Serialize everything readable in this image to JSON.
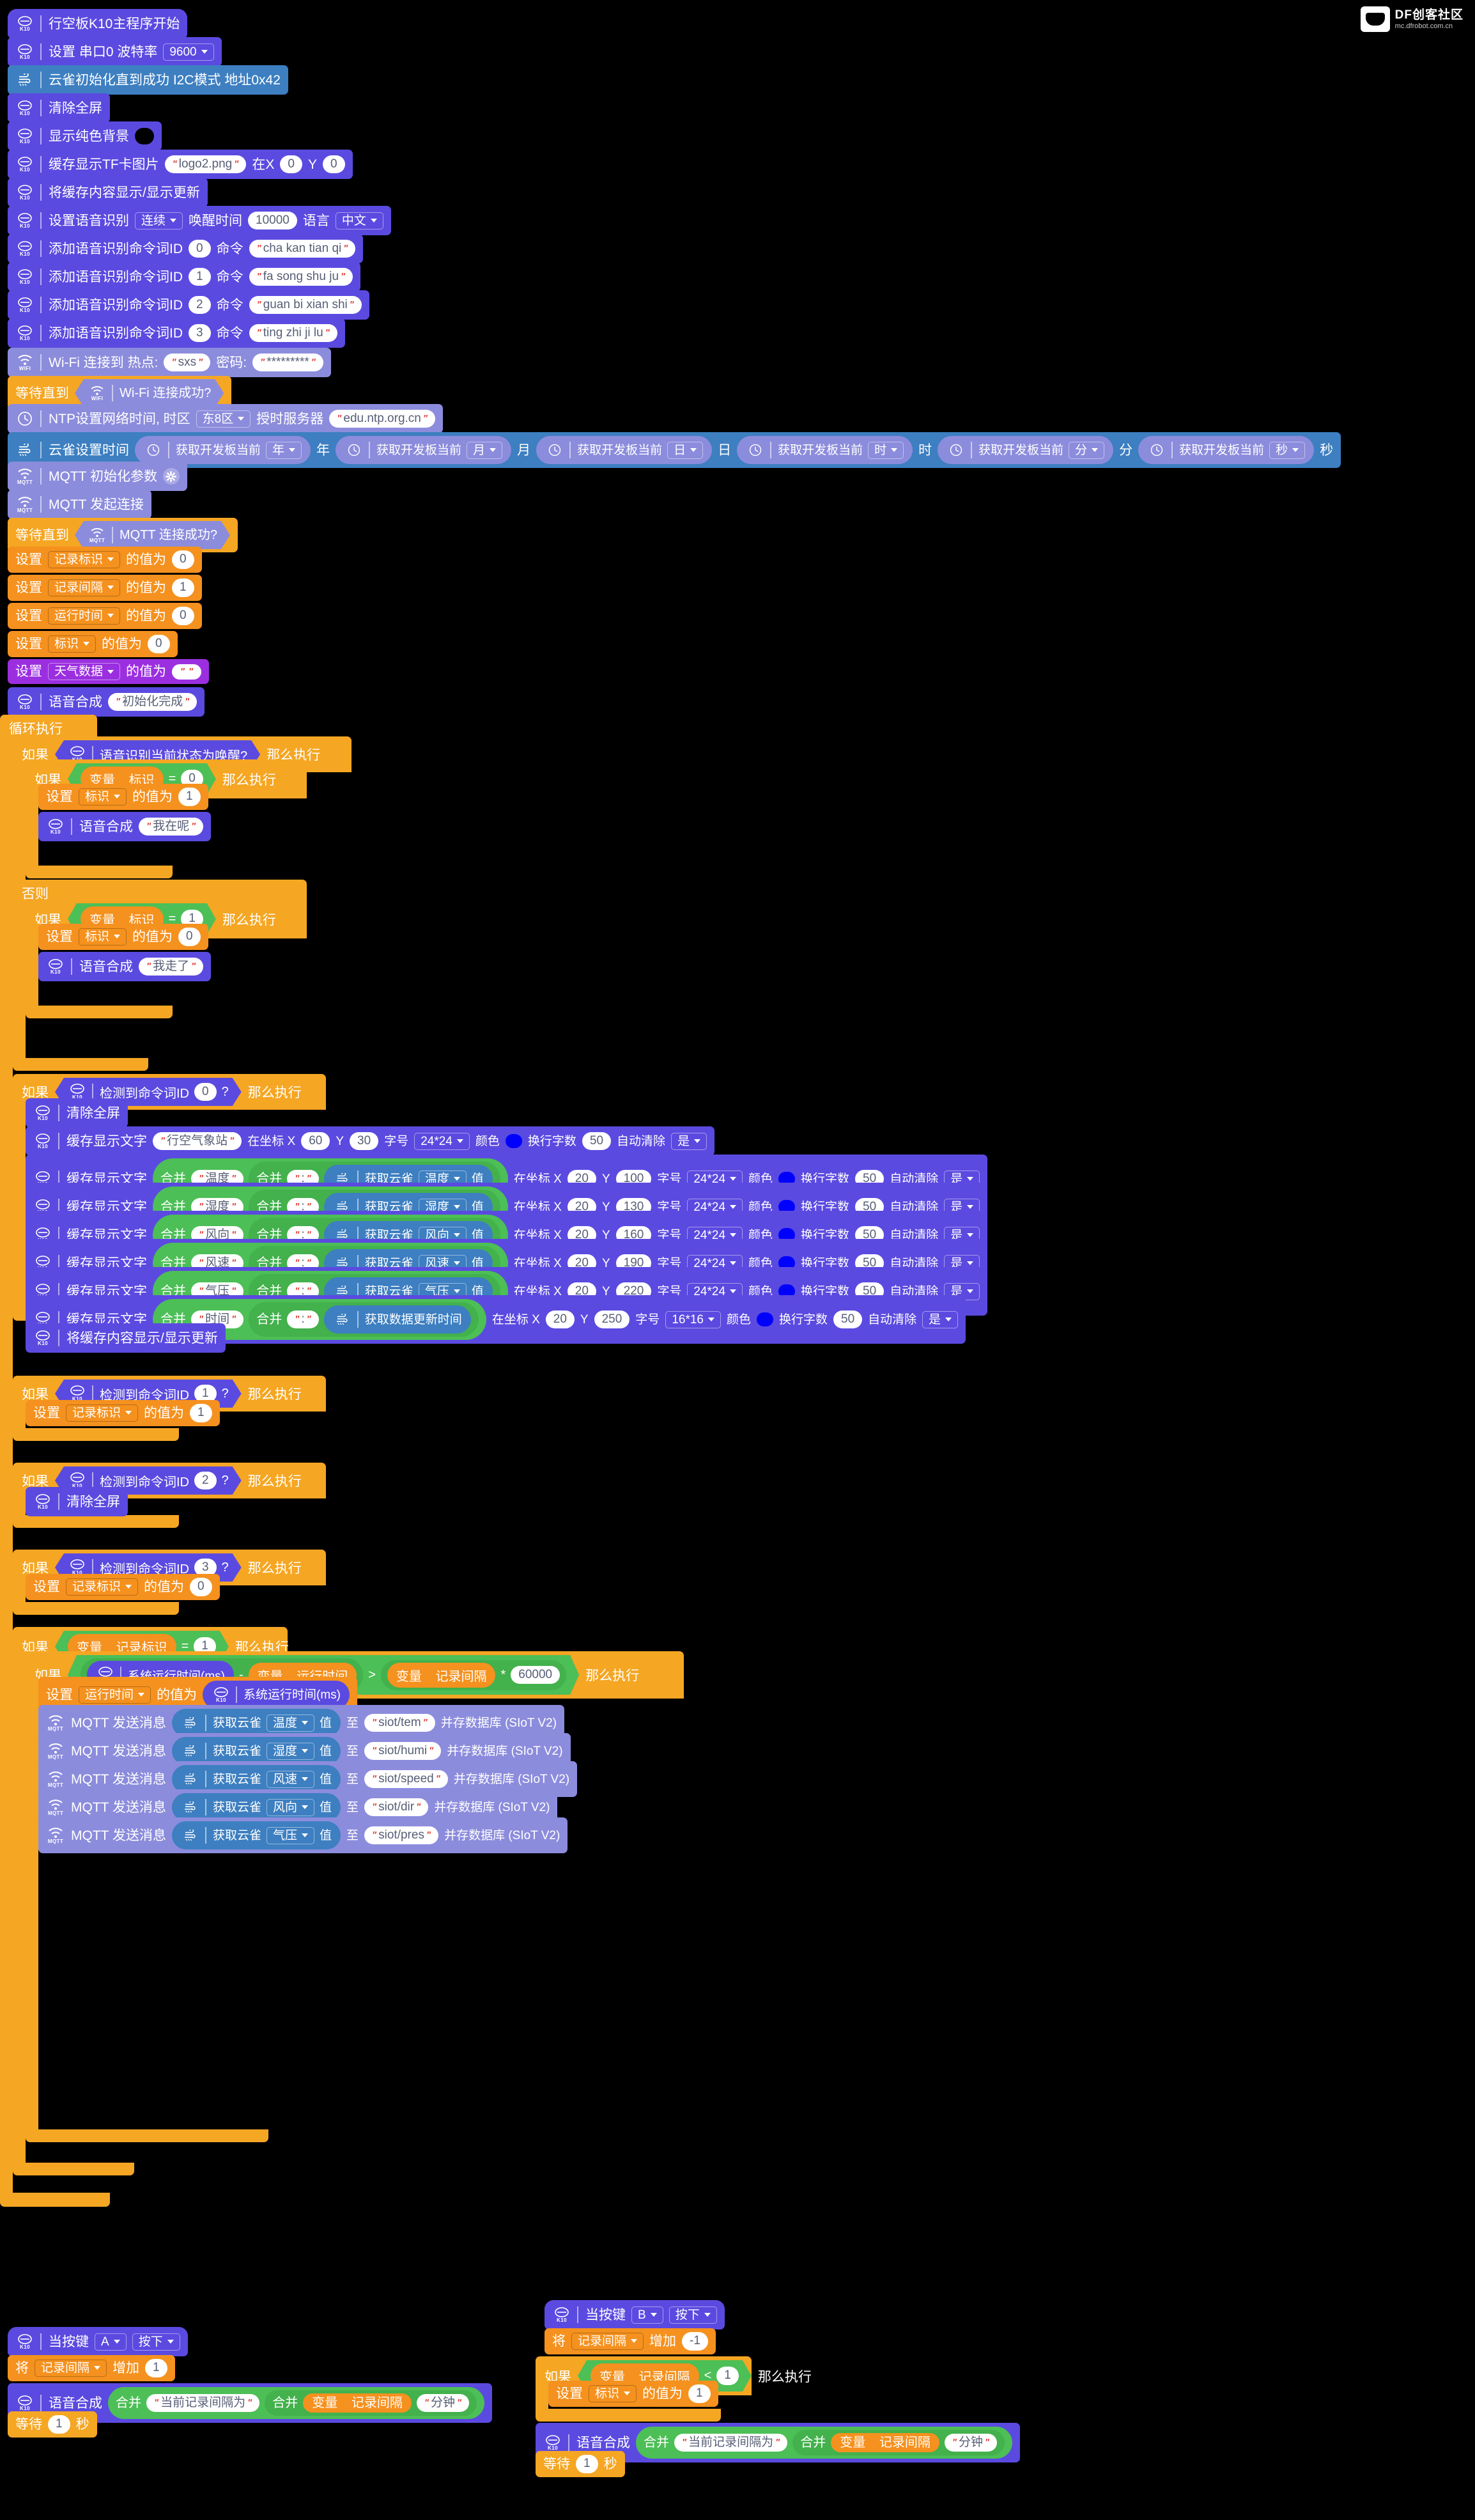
{
  "app": {
    "logo_title": "DF创客社区",
    "logo_sub": "mc.dfrobot.com.cn"
  },
  "icons": {
    "k10": "k10-board-icon",
    "sensor": "lark-weather-sensor-icon",
    "wifi": "wifi-icon",
    "mqtt": "mqtt-icon",
    "clock": "clock-icon",
    "gear": "gear-icon"
  },
  "labels": {
    "k10_chip": "K10",
    "wifi_chip": "WIFI",
    "mqtt_chip": "MQTT",
    "if": "如果",
    "then": "那么执行",
    "else": "否则",
    "forever": "循环执行",
    "wait_until": "等待直到",
    "set": "设置",
    "value_to": "的值为",
    "change_by": "将",
    "increase": "增加",
    "variable": "变量",
    "join": "合并",
    "wait": "等待",
    "seconds": "秒",
    "at_coord_x": "在坐标 X",
    "coord_y": "Y",
    "font_size": "字号",
    "color": "颜色",
    "wrap_chars": "换行字数",
    "auto_clear": "自动清除",
    "yes": "是",
    "value": "值",
    "get_lark": "获取云雀",
    "to": "至",
    "save_db": "并存数据库 (SIoT V2)",
    "year": "年",
    "month": "月",
    "day": "日",
    "hour": "时",
    "minute": "分",
    "second": "秒"
  },
  "main_stack": {
    "hat": "行空板K10主程序开始",
    "serial": {
      "text": "设置 串口0 波特率",
      "baud": "9600"
    },
    "lark_init": "云雀初始化直到成功 I2C模式 地址0x42",
    "clear_screen": "清除全屏",
    "solid_bg": "显示纯色背景",
    "cache_tf_image": {
      "text": "缓存显示TF卡图片",
      "file": "logo2.png",
      "x_label": "在X",
      "x": "0",
      "y_label": "Y",
      "y": "0"
    },
    "refresh": "将缓存内容显示/显示更新",
    "voice_cfg": {
      "text": "设置语音识别",
      "mode": "连续",
      "wake_label": "唤醒时间",
      "wake": "10000",
      "lang_label": "语言",
      "lang": "中文"
    },
    "commands": [
      {
        "text": "添加语音识别命令词ID",
        "id": "0",
        "cmd_label": "命令",
        "cmd": "cha kan tian qi"
      },
      {
        "text": "添加语音识别命令词ID",
        "id": "1",
        "cmd_label": "命令",
        "cmd": "fa song shu ju"
      },
      {
        "text": "添加语音识别命令词ID",
        "id": "2",
        "cmd_label": "命令",
        "cmd": "guan bi xian shi"
      },
      {
        "text": "添加语音识别命令词ID",
        "id": "3",
        "cmd_label": "命令",
        "cmd": "ting zhi ji lu"
      }
    ],
    "wifi_connect": {
      "text": "Wi-Fi 连接到 热点:",
      "ssid": "sxs",
      "pwd_label": "密码:",
      "pwd": "*********"
    },
    "wifi_wait": "Wi-Fi 连接成功?",
    "ntp": {
      "text": "NTP设置网络时间, 时区",
      "zone": "东8区",
      "server_label": "授时服务器",
      "server": "edu.ntp.org.cn"
    },
    "lark_settime": {
      "text": "云雀设置时间",
      "get": "获取开发板当前"
    },
    "mqtt_init": "MQTT 初始化参数",
    "mqtt_connect": "MQTT 发起连接",
    "mqtt_wait": "MQTT 连接成功?",
    "setvars": [
      {
        "name": "记录标识",
        "value": "0"
      },
      {
        "name": "记录间隔",
        "value": "1"
      },
      {
        "name": "运行时间",
        "value": "0"
      },
      {
        "name": "标识",
        "value": "0"
      }
    ],
    "set_weather": {
      "name": "天气数据",
      "value": ""
    },
    "tts_init": {
      "text": "语音合成",
      "value": "初始化完成"
    }
  },
  "loop": {
    "if_wake": "语音识别当前状态为唤醒?",
    "branch_a": {
      "cond_var": "标识",
      "cond_op": "=",
      "cond_val": "0",
      "set_name": "标识",
      "set_val": "1",
      "tts": {
        "text": "语音合成",
        "value": "我在呢"
      }
    },
    "branch_b": {
      "cond_var": "标识",
      "cond_op": "=",
      "cond_val": "1",
      "set_name": "标识",
      "set_val": "0",
      "tts": {
        "text": "语音合成",
        "value": "我走了"
      }
    },
    "cmd0": {
      "cond": "检测到命令词ID",
      "id": "0",
      "clear": "清除全屏",
      "title_row": {
        "text": "缓存显示文字",
        "value": "行空气象站",
        "x": "60",
        "y": "30",
        "size": "24*24",
        "wrap": "50",
        "auto": "是"
      },
      "rows": [
        {
          "text": "缓存显示文字",
          "key": "温度",
          "sep": ":",
          "sensor": "温度",
          "x": "20",
          "y": "100",
          "size": "24*24",
          "wrap": "50",
          "auto": "是"
        },
        {
          "text": "缓存显示文字",
          "key": "湿度",
          "sep": ":",
          "sensor": "湿度",
          "x": "20",
          "y": "130",
          "size": "24*24",
          "wrap": "50",
          "auto": "是"
        },
        {
          "text": "缓存显示文字",
          "key": "风向",
          "sep": ":",
          "sensor": "风向",
          "x": "20",
          "y": "160",
          "size": "24*24",
          "wrap": "50",
          "auto": "是"
        },
        {
          "text": "缓存显示文字",
          "key": "风速",
          "sep": ":",
          "sensor": "风速",
          "x": "20",
          "y": "190",
          "size": "24*24",
          "wrap": "50",
          "auto": "是"
        },
        {
          "text": "缓存显示文字",
          "key": "气压",
          "sep": ":",
          "sensor": "气压",
          "x": "20",
          "y": "220",
          "size": "24*24",
          "wrap": "50",
          "auto": "是"
        }
      ],
      "time_row": {
        "text": "缓存显示文字",
        "key": "时间",
        "sep": ":",
        "sensor_block": "获取数据更新时间",
        "x": "20",
        "y": "250",
        "size": "16*16",
        "wrap": "50",
        "auto": "是"
      },
      "refresh": "将缓存内容显示/显示更新"
    },
    "cmd1": {
      "cond": "检测到命令词ID",
      "id": "1",
      "set_name": "记录标识",
      "set_val": "1"
    },
    "cmd2": {
      "cond": "检测到命令词ID",
      "id": "2",
      "clear": "清除全屏"
    },
    "cmd3": {
      "cond": "检测到命令词ID",
      "id": "3",
      "set_name": "记录标识",
      "set_val": "0"
    },
    "record": {
      "cond_var": "记录标识",
      "cond_op": "=",
      "cond_val": "1",
      "timer_block": "系统运行时间(ms)",
      "minus": "-",
      "var_runtime": "运行时间",
      "gt": ">",
      "var_interval": "记录间隔",
      "mult": "*",
      "mult_val": "60000",
      "set_runtime": {
        "name": "运行时间",
        "block": "系统运行时间(ms)"
      },
      "publish": [
        {
          "text": "MQTT 发送消息",
          "sensor": "温度",
          "topic": "siot/tem"
        },
        {
          "text": "MQTT 发送消息",
          "sensor": "湿度",
          "topic": "siot/humi"
        },
        {
          "text": "MQTT 发送消息",
          "sensor": "风速",
          "topic": "siot/speed"
        },
        {
          "text": "MQTT 发送消息",
          "sensor": "风向",
          "topic": "siot/dir"
        },
        {
          "text": "MQTT 发送消息",
          "sensor": "气压",
          "topic": "siot/pres"
        }
      ]
    }
  },
  "button_a": {
    "hat": "当按键",
    "key": "A",
    "action": "按下",
    "change": {
      "prefix": "将",
      "name": "记录间隔",
      "verb": "增加",
      "val": "1"
    },
    "tts": {
      "text": "语音合成",
      "join": "合并",
      "s1": "当前记录间隔为",
      "var": "记录间隔",
      "s2": "分钟"
    },
    "wait": {
      "text": "等待",
      "val": "1",
      "unit": "秒"
    }
  },
  "button_b": {
    "hat": "当按键",
    "key": "B",
    "action": "按下",
    "change": {
      "prefix": "将",
      "name": "记录间隔",
      "verb": "增加",
      "val": "-1"
    },
    "if": {
      "var": "记录间隔",
      "op": "<",
      "val": "1",
      "set_name": "标识",
      "set_val": "1"
    },
    "tts": {
      "text": "语音合成",
      "join": "合并",
      "s1": "当前记录间隔为",
      "var": "记录间隔",
      "s2": "分钟"
    },
    "wait": {
      "text": "等待",
      "val": "1",
      "unit": "秒"
    }
  },
  "colors": {
    "k10": "#5b4ae0",
    "sensor": "#3d7fc1",
    "network": "#8c8cdd",
    "control": "#f5a623",
    "variable": "#f5911e",
    "operator": "#4cbf56",
    "variable_purple": "#9b2fe0",
    "text_color_swatch": "#0000ff",
    "bg_swatch": "#000000"
  }
}
